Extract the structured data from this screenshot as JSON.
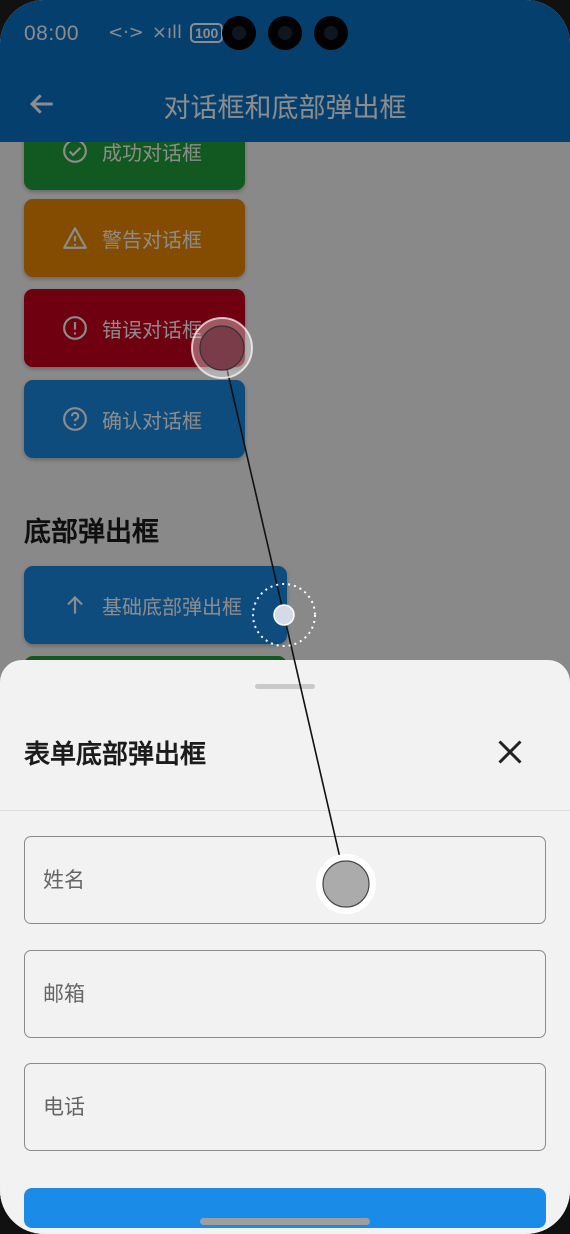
{
  "status_bar": {
    "time": "08:00",
    "network_label": "<·>",
    "signal_label": "×ıll",
    "battery": "100"
  },
  "app_bar": {
    "title": "对话框和底部弹出框",
    "back_icon": "arrow-left-icon"
  },
  "dialog_buttons": [
    {
      "label": "成功对话框",
      "icon": "check-circle-icon",
      "color": "#1fa33b"
    },
    {
      "label": "警告对话框",
      "icon": "warning-triangle-icon",
      "color": "#f08a00"
    },
    {
      "label": "错误对话框",
      "icon": "error-circle-icon",
      "color": "#c8001e"
    },
    {
      "label": "确认对话框",
      "icon": "help-circle-icon",
      "color": "#1a8be6"
    }
  ],
  "bottom_sheet_section": {
    "title": "底部弹出框",
    "basic_button_label": "基础底部弹出框",
    "basic_button_icon": "arrow-up-icon"
  },
  "form_sheet": {
    "title": "表单底部弹出框",
    "close_icon": "close-icon",
    "fields": [
      {
        "placeholder": "姓名"
      },
      {
        "placeholder": "邮箱"
      },
      {
        "placeholder": "电话"
      }
    ]
  },
  "colors": {
    "primary": "#1a8be6",
    "success": "#1fa33b",
    "warning": "#f08a00",
    "error": "#c8001e",
    "sheet_background": "#f2f2f2"
  }
}
